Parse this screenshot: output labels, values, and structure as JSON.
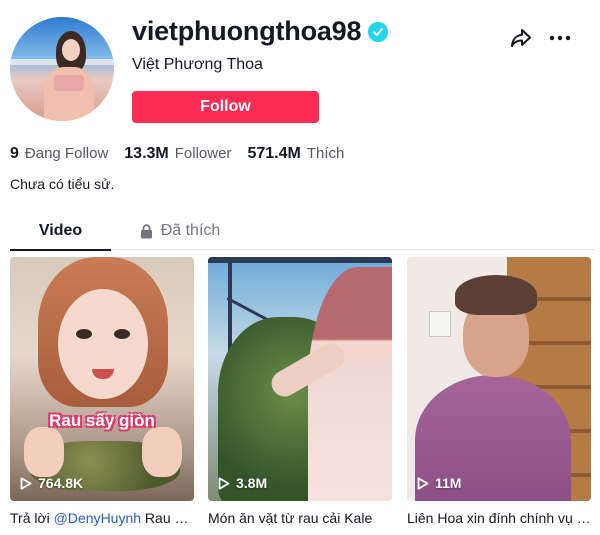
{
  "profile": {
    "username": "vietphuongthoa98",
    "display_name": "Việt Phương Thoa",
    "verified": true,
    "follow_label": "Follow",
    "bio": "Chưa có tiểu sử."
  },
  "stats": [
    {
      "value": "9",
      "label": "Đang Follow"
    },
    {
      "value": "13.3M",
      "label": "Follower"
    },
    {
      "value": "571.4M",
      "label": "Thích"
    }
  ],
  "tabs": [
    {
      "label": "Video",
      "active": true
    },
    {
      "label": "Đã thích",
      "locked": true
    }
  ],
  "videos": [
    {
      "views": "764.8K",
      "overlay_text": "Rau sấy giòn",
      "caption_prefix": "Trả lời ",
      "caption_mention": "@DenyHuynh",
      "caption_suffix": " Rau sấy giòn"
    },
    {
      "views": "3.8M",
      "caption": "Món ăn vặt từ rau cải Kale"
    },
    {
      "views": "11M",
      "caption": "Liên Hoa xin đính chính vụ việc"
    }
  ],
  "colors": {
    "accent": "#fe2c55",
    "verified_badge": "#20d5ec",
    "mention": "#2b5db9",
    "text_primary": "#161823",
    "text_secondary": "#73757c"
  },
  "icons": {
    "share": "share-icon",
    "more": "more-icon",
    "lock": "lock-icon",
    "play": "play-icon",
    "verified": "verified-checkmark-icon"
  }
}
